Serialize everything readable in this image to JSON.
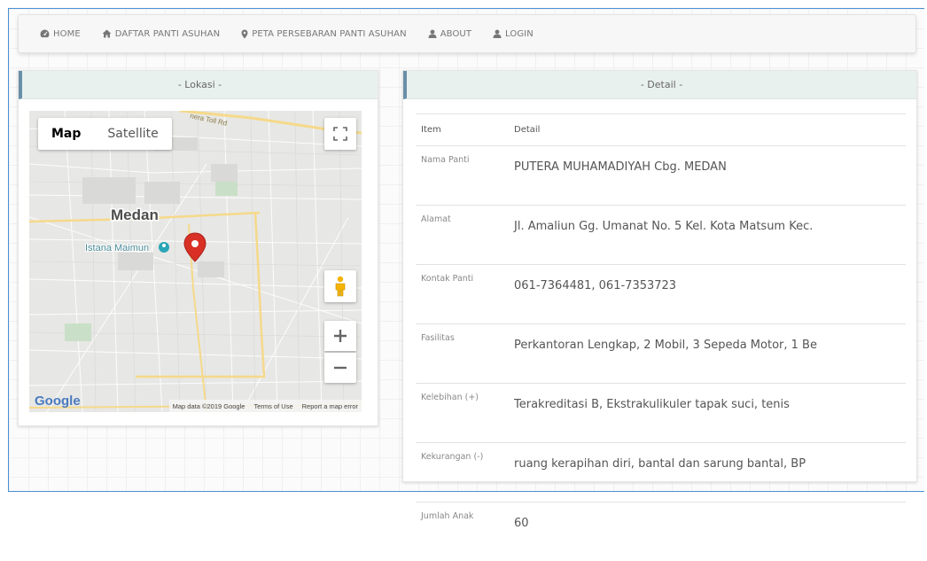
{
  "nav": {
    "items": [
      {
        "label": "HOME",
        "icon": "dashboard-icon"
      },
      {
        "label": "DAFTAR PANTI ASUHAN",
        "icon": "home-icon"
      },
      {
        "label": "PETA PERSEBARAN PANTI ASUHAN",
        "icon": "map-marker-icon"
      },
      {
        "label": "ABOUT",
        "icon": "user-icon"
      },
      {
        "label": "LOGIN",
        "icon": "user-icon"
      }
    ]
  },
  "lokasi": {
    "title": "- Lokasi -",
    "map": {
      "type_map": "Map",
      "type_satellite": "Satellite",
      "city_label": "Medan",
      "poi_label": "Istana Maimun",
      "road_label": "Medan-Binjai-Tebing Tinggi Toll Rd",
      "road_label_visible": "nera Toll Rd",
      "logo": "Google",
      "attribution": "Map data ©2019 Google",
      "terms": "Terms of Use",
      "report": "Report a map error",
      "marker_color": "#d93025"
    }
  },
  "detail": {
    "title": "- Detail -",
    "headers": {
      "item": "Item",
      "detail": "Detail"
    },
    "rows": [
      {
        "key": "Nama Panti",
        "value": "PUTERA MUHAMADIYAH Cbg. MEDAN"
      },
      {
        "key": "Alamat",
        "value": "Jl. Amaliun Gg. Umanat No. 5 Kel. Kota Matsum Kec."
      },
      {
        "key": "Kontak Panti",
        "value": "061-7364481, 061-7353723"
      },
      {
        "key": "Fasilitas",
        "value": "Perkantoran Lengkap, 2 Mobil, 3 Sepeda Motor, 1 Be"
      },
      {
        "key": "Kelebihan (+)",
        "value": "Terakreditasi B, Ekstrakulikuler tapak suci, tenis"
      },
      {
        "key": "Kekurangan (-)",
        "value": "ruang kerapihan diri, bantal dan sarung bantal, BP"
      },
      {
        "key": "Jumlah Anak",
        "value": "60"
      }
    ]
  },
  "colors": {
    "accent_border": "#4a8fd6",
    "panel_header_bg": "#e9f1ee",
    "panel_header_stripe": "#6a8fa8"
  }
}
